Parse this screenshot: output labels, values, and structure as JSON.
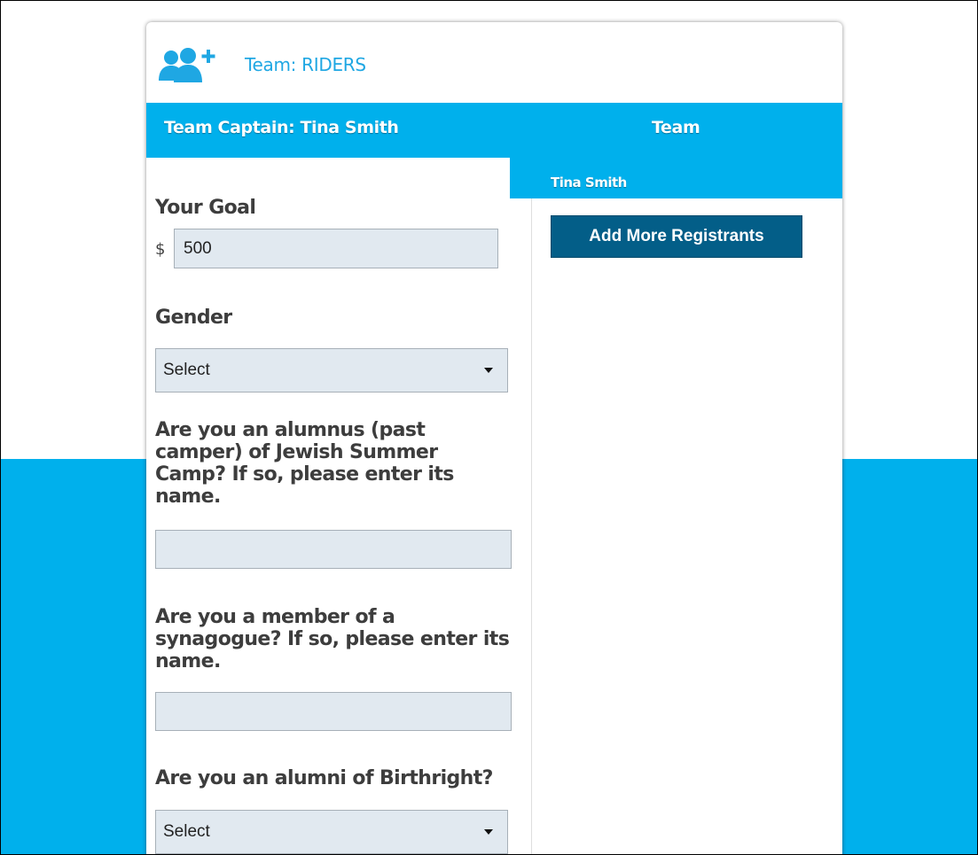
{
  "header": {
    "team_icon": "add-group-icon",
    "team_title": "Team: RIDERS",
    "captain_label": "Team Captain: Tina Smith",
    "team_heading": "Team"
  },
  "team_panel": {
    "members": [
      "Tina Smith"
    ],
    "add_button_label": "Add More Registrants"
  },
  "form": {
    "goal": {
      "label": "Your Goal",
      "currency": "$",
      "value": "500"
    },
    "gender": {
      "label": "Gender",
      "selected": "Select"
    },
    "camp": {
      "label": "Are you an alumnus (past camper) of Jewish Summer Camp? If so, please enter its name.",
      "value": ""
    },
    "synagogue": {
      "label": "Are you a member of a synagogue? If so, please enter its name.",
      "value": ""
    },
    "birthright": {
      "label": "Are you an alumni of Birthright?",
      "selected": "Select"
    }
  },
  "colors": {
    "accent_blue": "#00b0ec",
    "button_dark_blue": "#035e88",
    "input_bg": "#e1e9f0",
    "title_blue": "#1fa7e3"
  }
}
